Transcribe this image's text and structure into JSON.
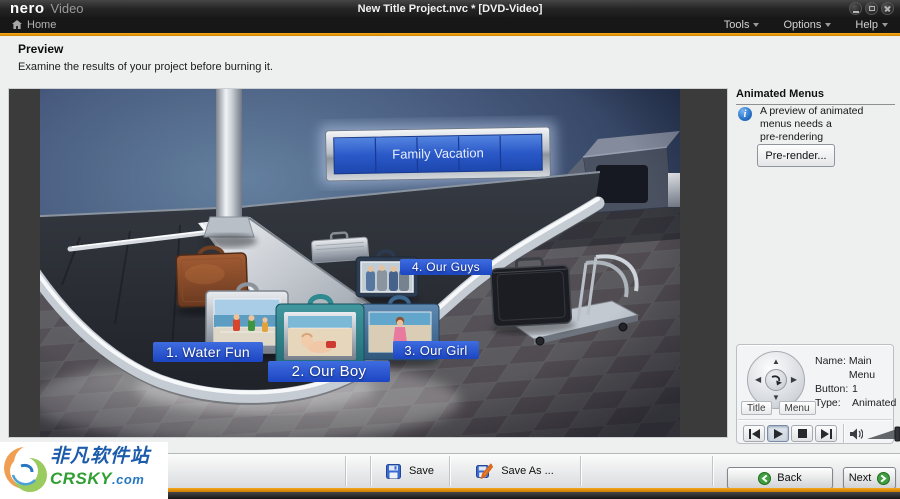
{
  "colors": {
    "accent_orange": "#f8ab1c",
    "menu_button_blue": "#2a53cf",
    "watermark_green": "#2f9e33",
    "watermark_blue": "#1d5cab"
  },
  "header": {
    "app_name": "nero",
    "app_type": "Video",
    "title": "New Title Project.nvc * [DVD-Video]",
    "home": "Home",
    "menus": [
      {
        "label": "Tools"
      },
      {
        "label": "Options"
      },
      {
        "label": "Help"
      }
    ],
    "window_icons": [
      "minimize-icon",
      "maximize-icon",
      "close-icon"
    ]
  },
  "page": {
    "heading": "Preview",
    "description": "Examine the results of your project before burning it."
  },
  "scene": {
    "sign": "Family Vacation",
    "buttons": [
      {
        "label": "1. Water Fun"
      },
      {
        "label": "2. Our Boy"
      },
      {
        "label": "3. Our Girl"
      },
      {
        "label": "4. Our Guys"
      }
    ]
  },
  "side_panel": {
    "title": "Animated Menus",
    "info_line1": "A preview of animated menus needs a",
    "info_line2": "pre-rendering",
    "prerender_button": "Pre-render...",
    "properties": [
      {
        "label": "Name:",
        "value": "Main Menu"
      },
      {
        "label": "Button:",
        "value": "1"
      },
      {
        "label": "Type:",
        "value": "Animated"
      }
    ],
    "title_button": "Title",
    "menu_button": "Menu"
  },
  "toolbar": {
    "save": "Save",
    "save_as": "Save As ...",
    "back": "Back",
    "next": "Next"
  },
  "watermark": {
    "line1": "非凡软件站",
    "brand": "CRSKY",
    "domain": ".com"
  }
}
